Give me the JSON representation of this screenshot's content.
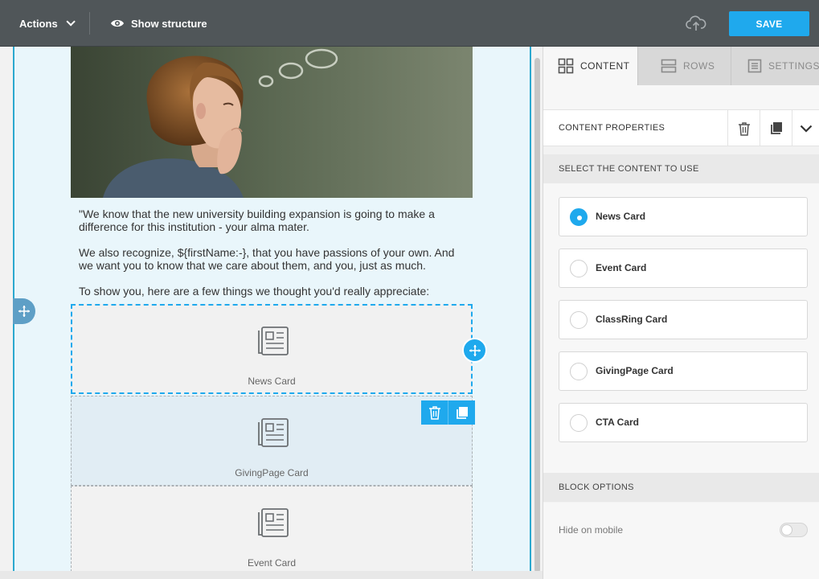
{
  "topbar": {
    "actions_label": "Actions",
    "show_structure_label": "Show structure",
    "save_label": "SAVE"
  },
  "email": {
    "paragraphs": [
      "\"We know that the new university building expansion is going to make a difference for this institution - your alma mater.",
      "We also recognize, ${firstName:-}, that you have passions of your own. And we want you to know that we care about them, and you, just as much.",
      "To show you, here are a few things we thought you'd really appreciate:"
    ],
    "blocks": [
      {
        "label": "News Card",
        "state": "selected"
      },
      {
        "label": "GivingPage Card",
        "state": "hover"
      },
      {
        "label": "Event Card",
        "state": "normal"
      }
    ]
  },
  "panel": {
    "tabs": [
      {
        "label": "CONTENT",
        "active": true
      },
      {
        "label": "ROWS",
        "active": false
      },
      {
        "label": "SETTINGS",
        "active": false
      }
    ],
    "content_properties_title": "CONTENT PROPERTIES",
    "select_content_title": "SELECT THE CONTENT TO USE",
    "options": [
      {
        "label": "News Card",
        "selected": true
      },
      {
        "label": "Event Card",
        "selected": false
      },
      {
        "label": "ClassRing Card",
        "selected": false
      },
      {
        "label": "GivingPage Card",
        "selected": false
      },
      {
        "label": "CTA Card",
        "selected": false
      }
    ],
    "block_options_title": "BLOCK OPTIONS",
    "hide_on_mobile_label": "Hide on mobile",
    "hide_on_mobile": false
  },
  "colors": {
    "accent": "#1fa9ed",
    "topbar": "#505659",
    "stage_bg": "#e9f6fb"
  }
}
